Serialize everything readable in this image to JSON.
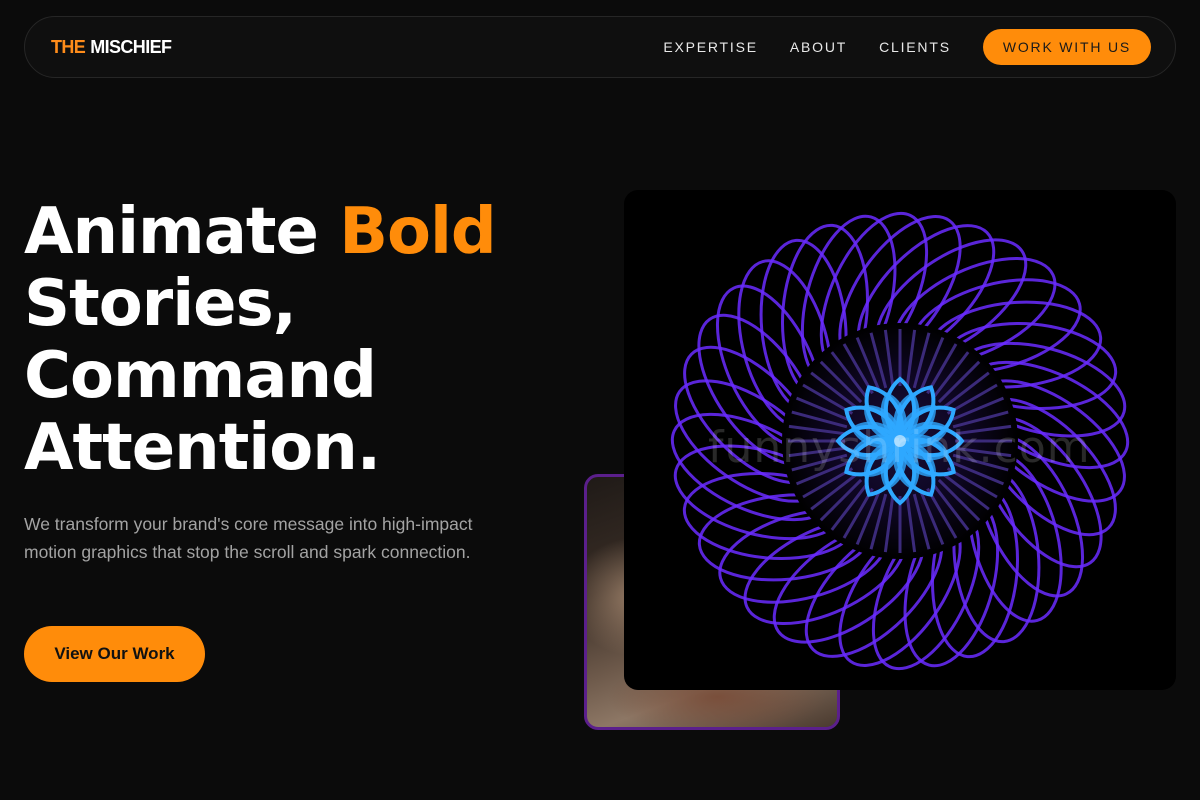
{
  "nav": {
    "logo_prefix": "THE",
    "logo_name": "MISCHIEF",
    "links": [
      {
        "label": "EXPERTISE"
      },
      {
        "label": "ABOUT"
      },
      {
        "label": "CLIENTS"
      }
    ],
    "cta_label": "WORK WITH US"
  },
  "hero": {
    "title_word1": "Animate",
    "title_accent": "Bold",
    "title_line2": "Stories,",
    "title_line3": "Command",
    "title_line4": "Attention.",
    "subtitle": "We transform your brand's core message into high-impact motion graphics that stop the scroll and spark connection.",
    "button_label": "View Our Work"
  },
  "media": {
    "watermark": "funnyshrink.com"
  },
  "colors": {
    "accent": "#ff8c0a",
    "background": "#0b0b0b",
    "ring": "#6a2cff",
    "flower": "#2ea8ff"
  },
  "icons": {
    "main_visual": "spirograph-ring-animation",
    "secondary_visual": "photo-thumbnail"
  }
}
